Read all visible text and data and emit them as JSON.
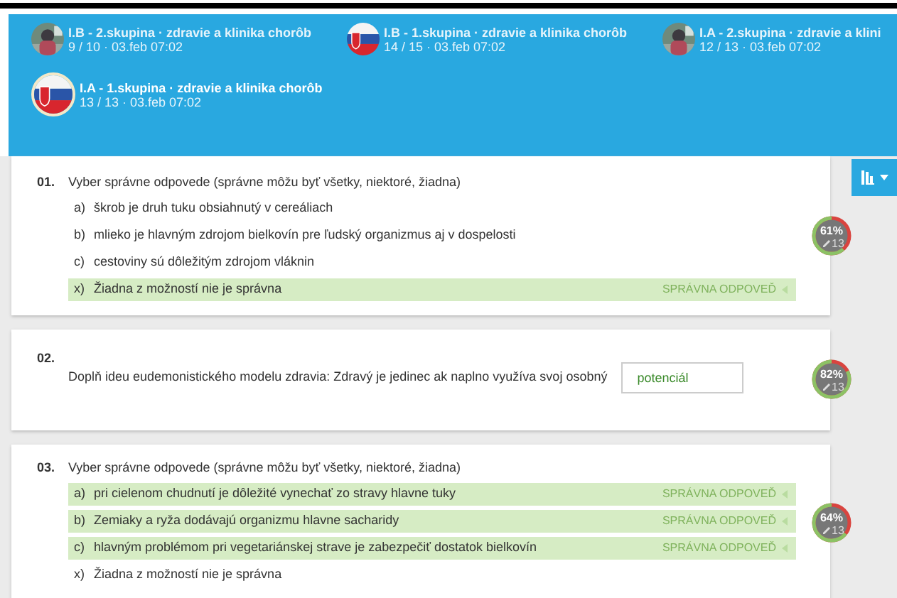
{
  "groups": [
    {
      "title": "I.B - 2.skupina · zdravie a klinika chorôb",
      "meta": "9 / 10 · 03.feb 07:02",
      "selected": false
    },
    {
      "title": "I.B - 1.skupina · zdravie a klinika chorôb",
      "meta": "14 / 15 · 03.feb 07:02",
      "kind": "flag",
      "selected": false
    },
    {
      "title": "I.A - 2.skupina · zdravie a klini",
      "meta": "12 / 13 · 03.feb 07:02",
      "selected": false
    },
    {
      "title": "I.A - 1.skupina · zdravie a klinika chorôb",
      "meta": "13 / 13 · 03.feb 07:02",
      "kind": "flag",
      "selected": true
    }
  ],
  "questions": [
    {
      "kind": "choice",
      "number": "01.",
      "text": "Vyber správne odpovede (správne môžu byť všetky, niektoré, žiadna)",
      "score": "61%",
      "level": 0.61,
      "count": "13",
      "answers": [
        {
          "letter": "a)",
          "text": "škrob je druh tuku obsiahnutý v cereáliach",
          "correct": false
        },
        {
          "letter": "b)",
          "text": "mlieko je hlavným zdrojom bielkovín pre ľudský organizmus aj v dospelosti",
          "correct": false
        },
        {
          "letter": "c)",
          "text": "cestoviny sú dôležitým zdrojom vláknin",
          "correct": false
        },
        {
          "letter": "x)",
          "text": "Žiadna z možností nie je správna",
          "correct": true,
          "tag": "SPRÁVNA ODPOVEĎ"
        }
      ]
    },
    {
      "kind": "fill",
      "number": "02.",
      "text": "Doplň ideu eudemonistického modelu zdravia: Zdravý je jedinec ak naplno využíva svoj osobný",
      "value": "potenciál",
      "score": "82%",
      "level": 0.82,
      "count": "13"
    },
    {
      "kind": "choice",
      "number": "03.",
      "text": "Vyber správne odpovede (správne môžu byť všetky, niektoré, žiadna)",
      "score": "64%",
      "level": 0.64,
      "count": "13",
      "answers": [
        {
          "letter": "a)",
          "text": "pri cielenom chudnutí je dôležité vynechať zo stravy hlavne tuky",
          "correct": true,
          "tag": "SPRÁVNA ODPOVEĎ"
        },
        {
          "letter": "b)",
          "text": "Zemiaky a ryža dodávajú organizmu hlavne sacharidy",
          "correct": true,
          "tag": "SPRÁVNA ODPOVEĎ"
        },
        {
          "letter": "c)",
          "text": "hlavným problémom pri vegetariánskej strave je zabezpečiť dostatok bielkovín",
          "correct": true,
          "tag": "SPRÁVNA ODPOVEĎ"
        },
        {
          "letter": "x)",
          "text": "Žiadna z možností nie je správna",
          "correct": false
        }
      ]
    }
  ]
}
